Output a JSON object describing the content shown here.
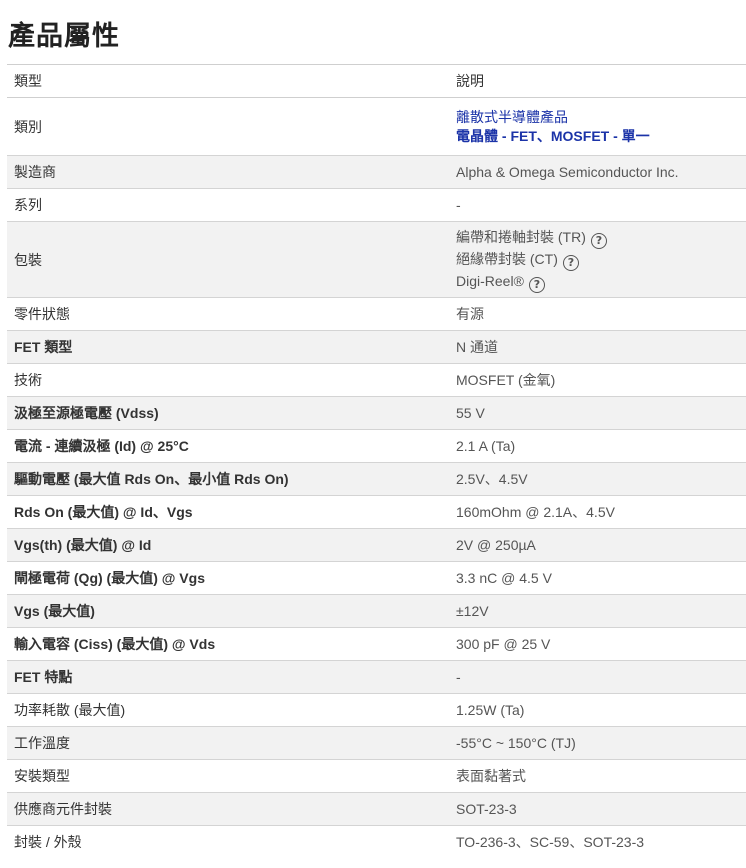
{
  "page_title": "產品屬性",
  "header": {
    "type": "類型",
    "description": "說明"
  },
  "category": {
    "label": "類別",
    "links": [
      "離散式半導體產品",
      "電晶體 - FET、MOSFET - 單一"
    ]
  },
  "packaging": {
    "label": "包裝",
    "options": [
      "編帶和捲軸封裝 (TR)",
      "絕緣帶封裝 (CT)",
      "Digi-Reel®"
    ],
    "help_icon": "?"
  },
  "rows_a": [
    {
      "label": "製造商",
      "value": "Alpha & Omega Semiconductor Inc."
    },
    {
      "label": "系列",
      "value": "-"
    }
  ],
  "rows_b": [
    {
      "label": "零件狀態",
      "value": "有源"
    },
    {
      "label": "FET 類型",
      "value": "N 通道"
    },
    {
      "label": "技術",
      "value": "MOSFET (金氧)"
    },
    {
      "label": "汲極至源極電壓 (Vdss)",
      "value": "55 V"
    },
    {
      "label": "電流 - 連續汲極 (Id) @ 25°C",
      "value": "2.1 A (Ta)"
    },
    {
      "label": "驅動電壓 (最大值 Rds On、最小值 Rds On)",
      "value": "2.5V、4.5V"
    },
    {
      "label": "Rds On (最大值) @ Id、Vgs",
      "value": "160mOhm @ 2.1A、4.5V"
    },
    {
      "label": "Vgs(th) (最大值) @ Id",
      "value": "2V @ 250µA"
    },
    {
      "label": "閘極電荷 (Qg) (最大值) @ Vgs",
      "value": "3.3 nC @ 4.5 V"
    },
    {
      "label": "Vgs (最大值)",
      "value": "±12V"
    },
    {
      "label": "輸入電容 (Ciss) (最大值) @ Vds",
      "value": "300 pF @ 25 V"
    },
    {
      "label": "FET 特點",
      "value": "-"
    },
    {
      "label": "功率耗散 (最大值)",
      "value": "1.25W (Ta)"
    },
    {
      "label": "工作溫度",
      "value": "-55°C ~ 150°C (TJ)"
    },
    {
      "label": "安裝類型",
      "value": "表面黏著式"
    },
    {
      "label": "供應商元件封裝",
      "value": "SOT-23-3"
    },
    {
      "label": "封裝 / 外殼",
      "value": "TO-236-3、SC-59、SOT-23-3"
    }
  ]
}
